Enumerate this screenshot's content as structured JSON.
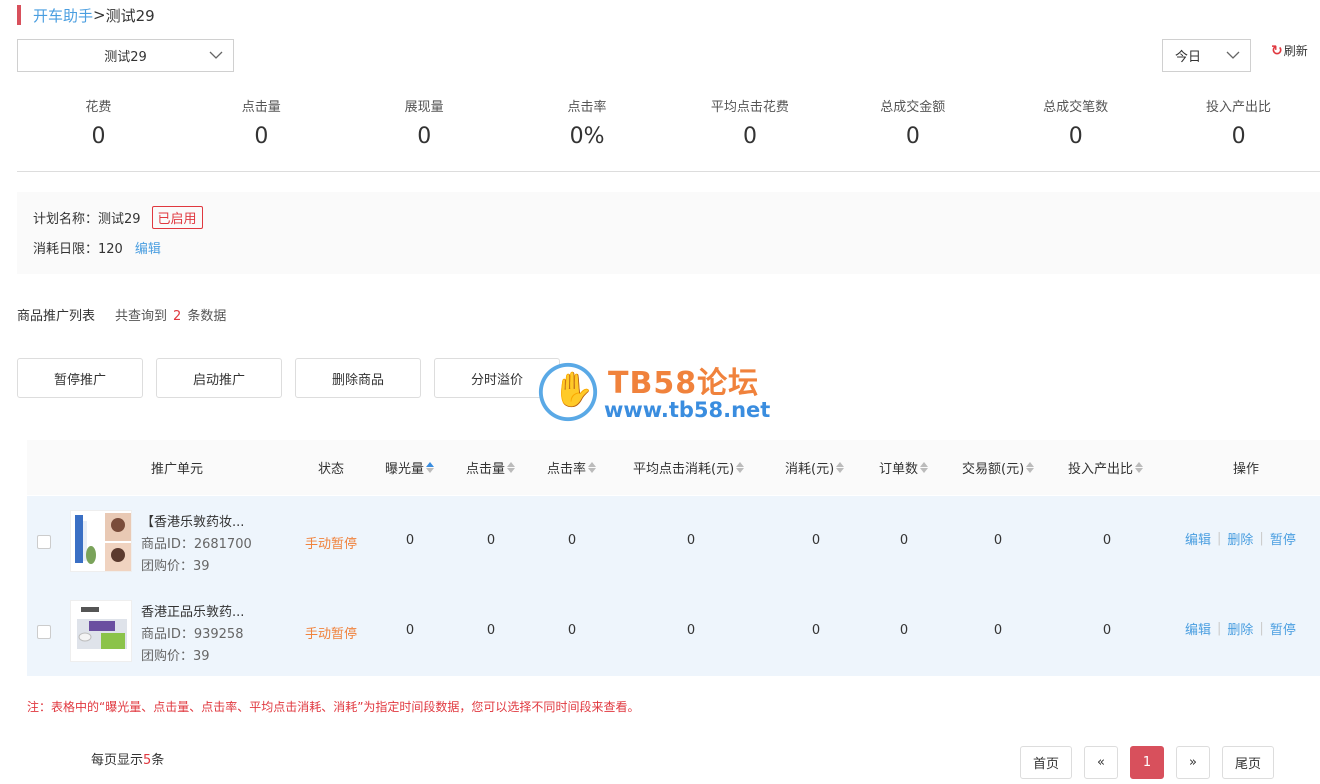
{
  "breadcrumb": {
    "root": "开车助手",
    "separator": ">",
    "current": "测试29"
  },
  "plan_select": {
    "value": "测试29"
  },
  "date_select": {
    "value": "今日"
  },
  "refresh": {
    "icon": "refresh-icon",
    "label": "刷新"
  },
  "stats": [
    {
      "label": "花费",
      "value": "0"
    },
    {
      "label": "点击量",
      "value": "0"
    },
    {
      "label": "展现量",
      "value": "0"
    },
    {
      "label": "点击率",
      "value": "0%"
    },
    {
      "label": "平均点击花费",
      "value": "0"
    },
    {
      "label": "总成交金额",
      "value": "0"
    },
    {
      "label": "总成交笔数",
      "value": "0"
    },
    {
      "label": "投入产出比",
      "value": "0"
    }
  ],
  "plan_info": {
    "name_label": "计划名称：测试29",
    "status_badge": "已启用",
    "limit_label": "消耗日限：120",
    "edit_label": "编辑"
  },
  "list": {
    "title": "商品推广列表",
    "count_prefix": "共查询到",
    "count": "2",
    "count_suffix": "条数据"
  },
  "actions": {
    "pause": "暂停推广",
    "start": "启动推广",
    "delete": "删除商品",
    "timeslot": "分时溢价"
  },
  "watermark": {
    "title": "TB58论坛",
    "url": "www.tb58.net"
  },
  "table": {
    "headers": {
      "unit": "推广单元",
      "status": "状态",
      "impressions": "曝光量",
      "clicks": "点击量",
      "ctr": "点击率",
      "avg_cpc": "平均点击消耗(元)",
      "spend": "消耗(元)",
      "orders": "订单数",
      "gmv": "交易额(元)",
      "roi": "投入产出比",
      "ops": "操作"
    },
    "rows": [
      {
        "title": "【香港乐敦药妆...",
        "pid": "商品ID：2681700",
        "price": "团购价：39",
        "status": "手动暂停",
        "impressions": "0",
        "clicks": "0",
        "ctr": "0",
        "avg_cpc": "0",
        "spend": "0",
        "orders": "0",
        "gmv": "0",
        "roi": "0",
        "op_edit": "编辑",
        "op_delete": "删除",
        "op_pause": "暂停"
      },
      {
        "title": "香港正品乐敦药...",
        "pid": "商品ID：939258",
        "price": "团购价：39",
        "status": "手动暂停",
        "impressions": "0",
        "clicks": "0",
        "ctr": "0",
        "avg_cpc": "0",
        "spend": "0",
        "orders": "0",
        "gmv": "0",
        "roi": "0",
        "op_edit": "编辑",
        "op_delete": "删除",
        "op_pause": "暂停"
      }
    ]
  },
  "note": "注：表格中的“曝光量、点击量、点击率、平均点击消耗、消耗”为指定时间段数据，您可以选择不同时间段来查看。",
  "per_page": {
    "prefix": "每页显示",
    "n": "5",
    "suffix": "条"
  },
  "pager": {
    "first": "首页",
    "prev": "«",
    "current": "1",
    "next": "»",
    "last": "尾页"
  }
}
